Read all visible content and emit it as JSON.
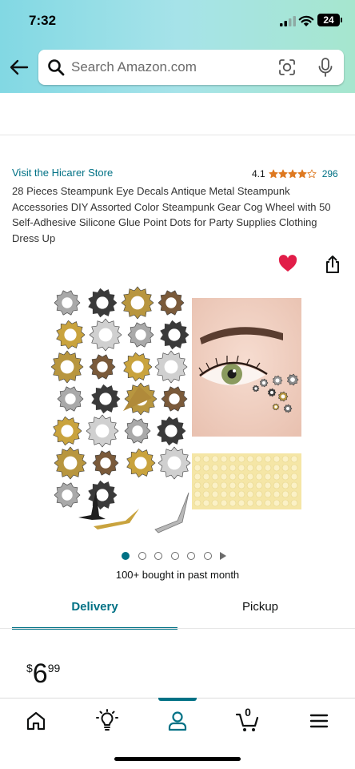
{
  "status_bar": {
    "time": "7:32",
    "battery": "24"
  },
  "search": {
    "placeholder": "Search Amazon.com"
  },
  "product": {
    "store_link": "Visit the Hicarer Store",
    "rating": "4.1",
    "rating_value": 4.1,
    "review_count": "296",
    "title": "28 Pieces Steampunk Eye Decals Antique Metal Steampunk Accessories DIY Assorted Color Steampunk Gear Cog Wheel with 50 Self-Adhesive Silicone Glue Point Dots for Party Supplies Clothing Dress Up",
    "image_count": 6,
    "active_image": 1,
    "bought_text": "100+ bought in past month"
  },
  "tabs": {
    "delivery": "Delivery",
    "pickup": "Pickup"
  },
  "price": {
    "symbol": "$",
    "whole": "6",
    "fraction": "99"
  },
  "bottom_nav": {
    "items": [
      "home-icon",
      "lightbulb-icon",
      "account-icon",
      "cart-icon",
      "menu-icon"
    ],
    "active": "account-icon",
    "cart_count": "0"
  },
  "colors": {
    "accent": "#007185",
    "star": "#de7921",
    "heart": "#e11d48",
    "header_gradient": [
      "#82d8e3",
      "#a6e6ce"
    ]
  }
}
